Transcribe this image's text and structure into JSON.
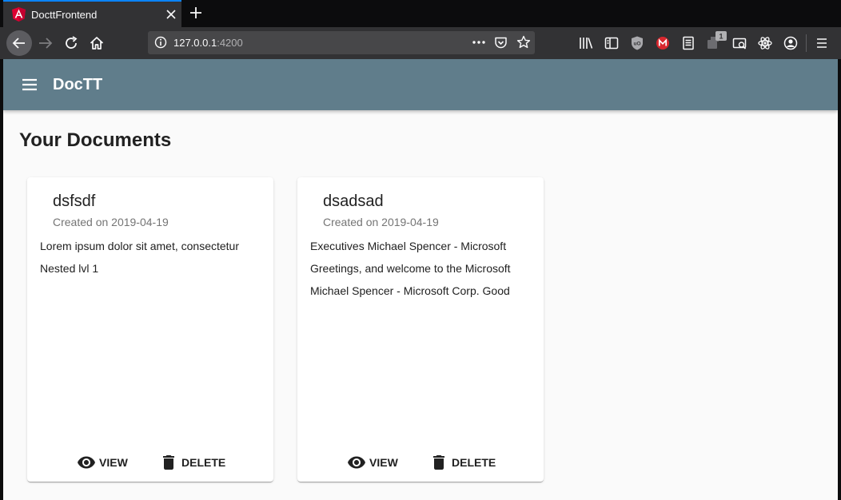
{
  "browser": {
    "tab_title": "DocttFrontend",
    "url_host": "127.0.0.1",
    "url_port": ":4200",
    "extension_badge": "1"
  },
  "app": {
    "title": "DocTT",
    "page_title": "Your Documents"
  },
  "documents": [
    {
      "title": "dsfsdf",
      "created": "Created on 2019-04-19",
      "lines": [
        "Lorem ipsum dolor sit amet, consectetur",
        "Nested lvl 1"
      ],
      "view_label": "VIEW",
      "delete_label": "DELETE"
    },
    {
      "title": "dsadsad",
      "created": "Created on 2019-04-19",
      "lines": [
        "Executives Michael Spencer - Microsoft",
        "Greetings, and welcome to the Microsoft",
        "Michael Spencer - Microsoft Corp. Good"
      ],
      "view_label": "VIEW",
      "delete_label": "DELETE"
    }
  ],
  "colors": {
    "app_bar": "#607d8b",
    "page_bg": "#fafafa",
    "card_bg": "#ffffff",
    "tab_accent": "#0a84ff"
  }
}
